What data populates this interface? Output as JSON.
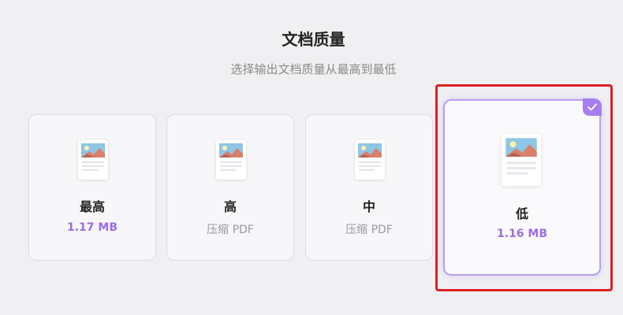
{
  "header": {
    "title": "文档质量",
    "subtitle": "选择输出文档质量从最高到最低"
  },
  "options": [
    {
      "name": "最高",
      "size": "1.17 MB",
      "selected": false
    },
    {
      "name": "高",
      "size": "压缩 PDF",
      "selected": false
    },
    {
      "name": "中",
      "size": "压缩 PDF",
      "selected": false
    },
    {
      "name": "低",
      "size": "1.16 MB",
      "selected": true
    }
  ],
  "colors": {
    "accent": "#a57ef0",
    "selected_border": "#b99cf0",
    "highlight": "#e02020",
    "size_text": "#9c6ce0"
  },
  "icons": {
    "document": "document-image-icon",
    "check": "check-icon"
  }
}
